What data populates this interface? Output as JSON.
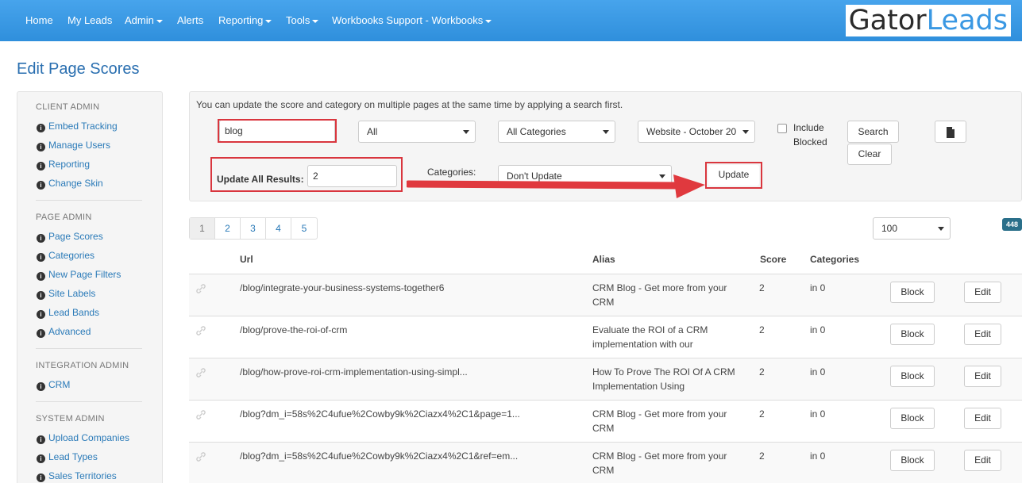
{
  "nav": {
    "items": [
      {
        "label": "Home",
        "dropdown": false
      },
      {
        "label": "My Leads",
        "dropdown": false
      },
      {
        "label": "Admin",
        "dropdown": true
      },
      {
        "label": "Alerts",
        "dropdown": false
      },
      {
        "label": "Reporting",
        "dropdown": true
      },
      {
        "label": "Tools",
        "dropdown": true
      },
      {
        "label": "Workbooks Support - Workbooks",
        "dropdown": true
      }
    ],
    "logo_part1": "Gator",
    "logo_part2": "Leads"
  },
  "page_title": "Edit Page Scores",
  "sidebar": {
    "sections": [
      {
        "heading": "CLIENT ADMIN",
        "items": [
          "Embed Tracking",
          "Manage Users",
          "Reporting",
          "Change Skin"
        ]
      },
      {
        "heading": "PAGE ADMIN",
        "items": [
          "Page Scores",
          "Categories",
          "New Page Filters",
          "Site Labels",
          "Lead Bands",
          "Advanced"
        ]
      },
      {
        "heading": "INTEGRATION ADMIN",
        "items": [
          "CRM"
        ]
      },
      {
        "heading": "SYSTEM ADMIN",
        "items": [
          "Upload Companies",
          "Lead Types",
          "Sales Territories"
        ]
      }
    ]
  },
  "search": {
    "hint": "You can update the score and category on multiple pages at the same time by applying a search first.",
    "query_value": "blog",
    "filter_all": "All",
    "filter_categories": "All Categories",
    "filter_website": "Website - October 20",
    "include_blocked_line1": "Include",
    "include_blocked_line2": "Blocked",
    "search_button": "Search",
    "clear_button": "Clear",
    "update_all_label": "Update All Results:",
    "update_all_value": "2",
    "categories_label": "Categories:",
    "categories_value": "Don't Update",
    "update_button": "Update"
  },
  "pagination": {
    "pages": [
      "1",
      "2",
      "3",
      "4",
      "5"
    ],
    "active": "1",
    "per_page": "100",
    "total_count": "448"
  },
  "table": {
    "headers": {
      "url": "Url",
      "alias": "Alias",
      "score": "Score",
      "categories": "Categories"
    },
    "block_label": "Block",
    "edit_label": "Edit",
    "rows": [
      {
        "url": "/blog/integrate-your-business-systems-together6",
        "alias_line1": "CRM Blog - Get more from your",
        "alias_line2": "CRM",
        "score": "2",
        "categories": "in 0"
      },
      {
        "url": "/blog/prove-the-roi-of-crm",
        "alias_line1": "Evaluate the ROI of a CRM",
        "alias_line2": "implementation with our",
        "score": "2",
        "categories": "in 0"
      },
      {
        "url": "/blog/how-prove-roi-crm-implementation-using-simpl...",
        "alias_line1": "How To Prove The ROI Of A CRM",
        "alias_line2": "Implementation Using",
        "score": "2",
        "categories": "in 0"
      },
      {
        "url": "/blog?dm_i=58s%2C4ufue%2Cowby9k%2Ciazx4%2C1&page=1...",
        "alias_line1": "CRM Blog - Get more from your",
        "alias_line2": "CRM",
        "score": "2",
        "categories": "in 0"
      },
      {
        "url": "/blog?dm_i=58s%2C4ufue%2Cowby9k%2Ciazx4%2C1&ref=em...",
        "alias_line1": "CRM Blog - Get more from your",
        "alias_line2": "CRM",
        "score": "2",
        "categories": "in 0"
      }
    ]
  },
  "colors": {
    "navbar": "#3a98e3",
    "link": "#2a7ab8",
    "highlight": "#d9363e",
    "arrow": "#e0393e"
  }
}
